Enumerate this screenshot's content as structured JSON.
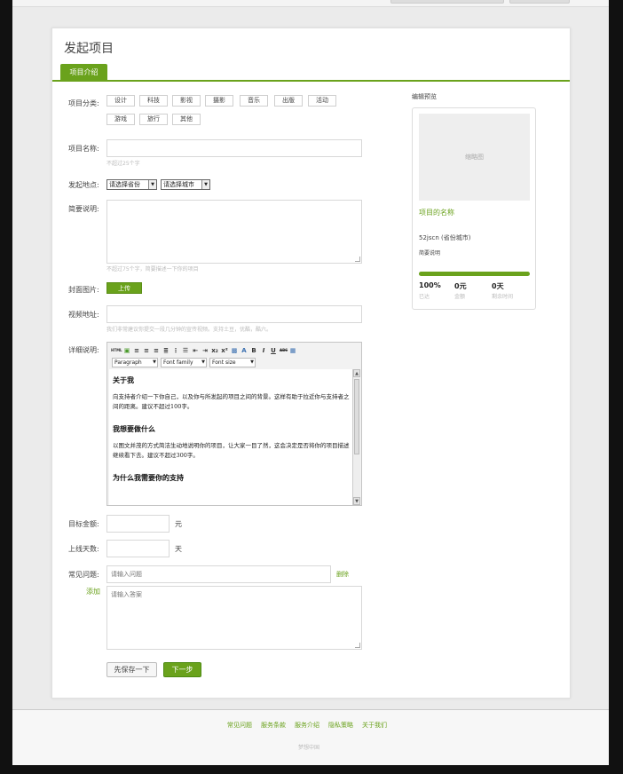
{
  "page": {
    "title": "发起项目",
    "tab": "项目介绍"
  },
  "form": {
    "category_label": "项目分类:",
    "categories": [
      "设计",
      "科技",
      "影视",
      "摄影",
      "音乐",
      "出版",
      "活动",
      "游戏",
      "旅行",
      "其他"
    ],
    "name_label": "项目名称:",
    "name_hint": "不超过25个字",
    "location_label": "发起地点:",
    "province_value": "请选择省份",
    "city_value": "请选择城市",
    "summary_label": "简要说明:",
    "summary_hint": "不超过75个字，简要描述一下你的项目",
    "cover_label": "封面图片:",
    "upload_label": "上传",
    "video_label": "视频地址:",
    "video_hint": "我们非常建议你提交一段几分钟的宣传视频。支持土豆，优酷，酷六。",
    "detail_label": "详细说明:",
    "goal_label": "目标金额:",
    "goal_unit": "元",
    "days_label": "上线天数:",
    "days_unit": "天",
    "faq_label": "常见问题:",
    "faq_add": "添加",
    "faq_delete": "删除",
    "faq_question_placeholder": "请输入问题",
    "faq_answer_placeholder": "请输入答案",
    "save_button": "先保存一下",
    "next_button": "下一步"
  },
  "editor": {
    "toolbar_icons": [
      "html-icon",
      "image-icon",
      "align-left-icon",
      "align-center-icon",
      "align-right-icon",
      "align-justify-icon",
      "ordered-list-icon",
      "unordered-list-icon",
      "outdent-icon",
      "indent-icon",
      "subscript-icon",
      "superscript-icon",
      "background-color-icon",
      "text-color-icon",
      "bold-icon",
      "italic-icon",
      "underline-icon",
      "strikethrough-icon",
      "table-icon"
    ],
    "format_select": "Paragraph",
    "font_family_select": "Font family",
    "font_size_select": "Font size",
    "h1": "关于我",
    "p1": "向支持者介绍一下你自己，以及你与所发起的项目之间的背景。这样有助于拉近你与支持者之间的距离。建议不超过100字。",
    "h2": "我想要做什么",
    "p2": "以图文并茂的方式简洁生动地说明你的项目，让大家一目了然，这会决定是否将你的项目描述继续看下去。建议不超过300字。",
    "h3": "为什么我需要你的支持"
  },
  "preview": {
    "title": "编辑预览",
    "thumbnail": "缩略图",
    "project_name": "项目的名称",
    "location": "52jscn (省份城市)",
    "summary": "简要说明",
    "progress_fraction": 1.0,
    "percent": "100%",
    "percent_label": "已达",
    "amount": "0元",
    "amount_label": "金额",
    "days": "0天",
    "days_label": "剩余时间"
  },
  "footer": {
    "links": [
      "常见问题",
      "服务条款",
      "服务介绍",
      "隐私策略",
      "关于我们"
    ],
    "copyright": "梦想中国"
  },
  "colors": {
    "accent": "#6aa21c",
    "background": "#ebebeb",
    "border": "#d8d8d8"
  }
}
